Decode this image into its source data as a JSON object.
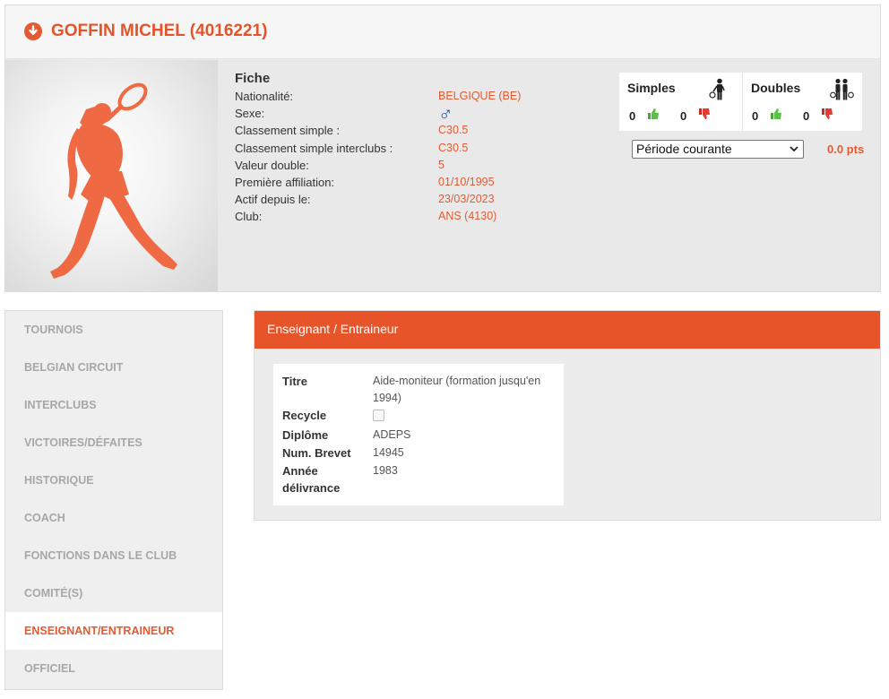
{
  "player": {
    "name": "GOFFIN MICHEL (4016221)",
    "fiche_title": "Fiche",
    "fields": [
      {
        "label": "Nationalité:",
        "value": "BELGIQUE (BE)"
      },
      {
        "label": "Sexe:",
        "value": "♂"
      },
      {
        "label": "Classement simple :",
        "value": "C30.5"
      },
      {
        "label": "Classement simple interclubs :",
        "value": "C30.5"
      },
      {
        "label": "Valeur double:",
        "value": "5"
      },
      {
        "label": "Première affiliation:",
        "value": "01/10/1995"
      },
      {
        "label": "Actif depuis le:",
        "value": "23/03/2023"
      },
      {
        "label": "Club:",
        "value": "ANS (4130)"
      }
    ]
  },
  "stats": {
    "simples": {
      "title": "Simples",
      "wins": "0",
      "losses": "0"
    },
    "doubles": {
      "title": "Doubles",
      "wins": "0",
      "losses": "0"
    }
  },
  "period": {
    "selected": "Période courante",
    "points": "0.0 pts"
  },
  "sidebar": {
    "items": [
      {
        "label": "TOURNOIS"
      },
      {
        "label": "BELGIAN CIRCUIT"
      },
      {
        "label": "INTERCLUBS"
      },
      {
        "label": "VICTOIRES/DÉFAITES"
      },
      {
        "label": "HISTORIQUE"
      },
      {
        "label": "COACH"
      },
      {
        "label": "FONCTIONS DANS LE CLUB"
      },
      {
        "label": "COMITÉ(S)"
      },
      {
        "label": "ENSEIGNANT/ENTRAINEUR"
      },
      {
        "label": "OFFICIEL"
      }
    ],
    "active_index": 8
  },
  "panel": {
    "title": "Enseignant / Entraineur",
    "rows": {
      "titre": {
        "label": "Titre",
        "value": "Aide-moniteur (formation jusqu'en 1994)"
      },
      "recycle": {
        "label": "Recycle",
        "checked": false
      },
      "diplome": {
        "label": "Diplôme",
        "value": "ADEPS"
      },
      "brevet": {
        "label": "Num. Brevet",
        "value": "14945"
      },
      "annee": {
        "label": "Année délivrance",
        "value": "1983"
      }
    }
  },
  "colors": {
    "accent": "#e35b32",
    "header_bar": "#e8542a",
    "male_symbol": "#1e5aa8"
  },
  "icons": [
    "download-circle-icon",
    "tennis-player-silhouette",
    "single-player-icon",
    "double-players-icon",
    "thumbs-up-icon",
    "thumbs-down-icon",
    "chevron-down-icon",
    "male-symbol-icon"
  ]
}
